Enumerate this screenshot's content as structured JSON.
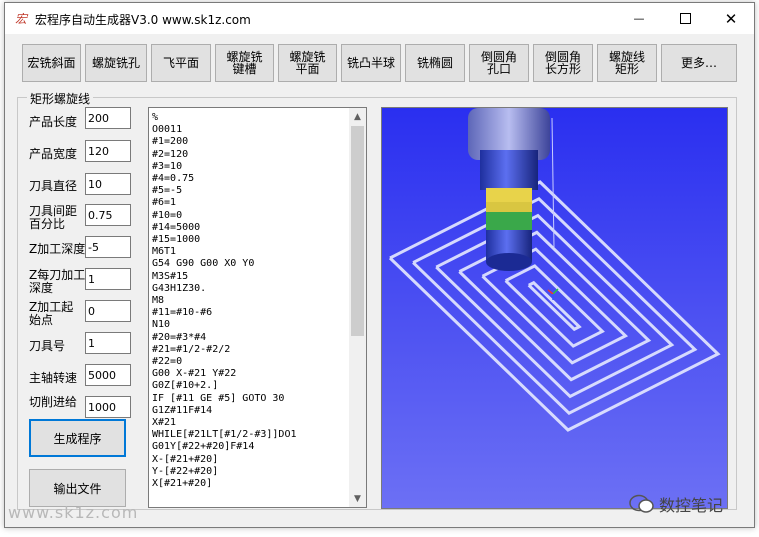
{
  "window": {
    "title": "宏程序自动生成器V3.0    www.sk1z.com",
    "app_icon_glyph": "宏",
    "controls": {
      "minimize": "—",
      "close": "✕"
    }
  },
  "toolbar": [
    "宏铣斜面",
    "螺旋铣孔",
    "飞平面",
    "螺旋铣\n键槽",
    "螺旋铣\n平面",
    "铣凸半球",
    "铣椭圆",
    "倒圆角\n孔口",
    "倒圆角\n长方形",
    "螺旋线\n矩形",
    "更多…"
  ],
  "group": {
    "title": "矩形螺旋线"
  },
  "params": [
    {
      "label": "产品长度",
      "value": "200"
    },
    {
      "label": "产品宽度",
      "value": "120"
    },
    {
      "label": "刀具直径",
      "value": "10"
    },
    {
      "label": "刀具间距\n百分比",
      "value": "0.75"
    },
    {
      "label": "Z加工深度",
      "value": "-5"
    },
    {
      "label": "Z每刀加工\n深度",
      "value": "1"
    },
    {
      "label": "Z加工起\n始点",
      "value": "0"
    },
    {
      "label": "刀具号",
      "value": "1"
    },
    {
      "label": "主轴转速",
      "value": "5000"
    },
    {
      "label": "切削进给",
      "value": "1000"
    }
  ],
  "buttons": {
    "generate": "生成程序",
    "export": "输出文件"
  },
  "code": [
    "%",
    "O0011",
    "#1=200",
    "#2=120",
    "#3=10",
    "#4=0.75",
    "#5=-5",
    "#6=1",
    "#10=0",
    "#14=5000",
    "#15=1000",
    "M6T1",
    "G54 G90 G00 X0 Y0",
    "M3S#15",
    "G43H1Z30.",
    "M8",
    "#11=#10-#6",
    "N10",
    "#20=#3*#4",
    "#21=#1/2-#2/2",
    "#22=0",
    "G00 X-#21 Y#22",
    "G0Z[#10+2.]",
    "IF [#11 GE #5] GOTO 30",
    "G1Z#11F#14",
    "X#21",
    "WHILE[#21LT[#1/2-#3]]DO1",
    "G01Y[#22+#20]F#14",
    "X-[#21+#20]",
    "Y-[#22+#20]",
    "X[#21+#20]"
  ],
  "watermarks": {
    "left": "www.sk1z.com",
    "right": "数控笔记"
  },
  "colors": {
    "viewport_bg": "#3b3df2",
    "toolpath": "#dfe3ff",
    "tool_body": "#2f45d8"
  }
}
